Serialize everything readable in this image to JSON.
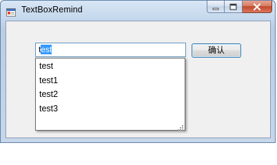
{
  "window": {
    "title": "TextBoxRemind",
    "controls": {
      "minimize_icon": "minimize-icon",
      "maximize_icon": "maximize-icon",
      "close_icon": "close-icon"
    }
  },
  "textbox": {
    "value_typed": "t",
    "value_selected": "est"
  },
  "confirm_button": {
    "label": "确认"
  },
  "suggestions": [
    "test",
    "test1",
    "test2",
    "test3"
  ],
  "colors": {
    "selection": "#3399ff",
    "textbox_border": "#5c93bc",
    "close_button": "#c2482b"
  }
}
